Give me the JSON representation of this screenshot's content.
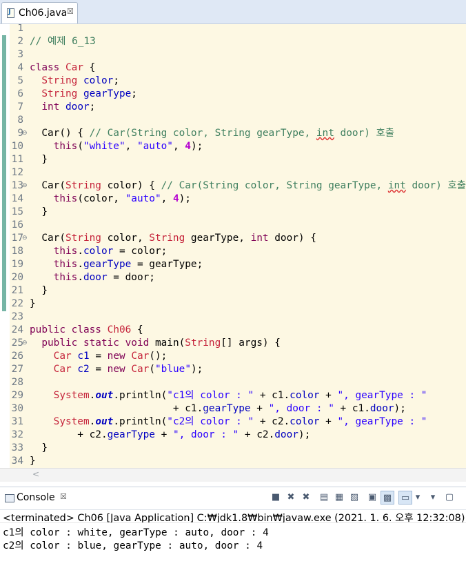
{
  "editor_tab": {
    "title": "Ch06.java",
    "close": "☒"
  },
  "code_lines": [
    {
      "n": "1",
      "fold": "",
      "segs": []
    },
    {
      "n": "2",
      "fold": "",
      "segs": [
        {
          "c": "cm",
          "t": "// 예제 6_13"
        }
      ]
    },
    {
      "n": "3",
      "fold": "",
      "segs": []
    },
    {
      "n": "4",
      "fold": "",
      "segs": [
        {
          "c": "kw",
          "t": "class"
        },
        {
          "c": "",
          "t": " "
        },
        {
          "c": "ty",
          "t": "Car"
        },
        {
          "c": "",
          "t": " {"
        }
      ]
    },
    {
      "n": "5",
      "fold": "",
      "segs": [
        {
          "c": "",
          "t": "  "
        },
        {
          "c": "ty",
          "t": "String"
        },
        {
          "c": "",
          "t": " "
        },
        {
          "c": "fd",
          "t": "color"
        },
        {
          "c": "",
          "t": ";"
        }
      ]
    },
    {
      "n": "6",
      "fold": "",
      "segs": [
        {
          "c": "",
          "t": "  "
        },
        {
          "c": "ty",
          "t": "String"
        },
        {
          "c": "",
          "t": " "
        },
        {
          "c": "fd",
          "t": "gearType"
        },
        {
          "c": "",
          "t": ";"
        }
      ]
    },
    {
      "n": "7",
      "fold": "",
      "segs": [
        {
          "c": "",
          "t": "  "
        },
        {
          "c": "kw",
          "t": "int"
        },
        {
          "c": "",
          "t": " "
        },
        {
          "c": "fd",
          "t": "door"
        },
        {
          "c": "",
          "t": ";"
        }
      ]
    },
    {
      "n": "8",
      "fold": "",
      "segs": []
    },
    {
      "n": "9",
      "fold": "⊖",
      "segs": [
        {
          "c": "",
          "t": "  Car() { "
        },
        {
          "c": "cm",
          "t": "// Car(String color, String gearType, "
        },
        {
          "c": "cm sq",
          "t": "int"
        },
        {
          "c": "cm",
          "t": " door) 호출"
        }
      ]
    },
    {
      "n": "10",
      "fold": "",
      "segs": [
        {
          "c": "",
          "t": "    "
        },
        {
          "c": "kw",
          "t": "this"
        },
        {
          "c": "",
          "t": "("
        },
        {
          "c": "st",
          "t": "\"white\""
        },
        {
          "c": "",
          "t": ", "
        },
        {
          "c": "st",
          "t": "\"auto\""
        },
        {
          "c": "",
          "t": ", "
        },
        {
          "c": "nm",
          "t": "4"
        },
        {
          "c": "",
          "t": ");"
        }
      ]
    },
    {
      "n": "11",
      "fold": "",
      "segs": [
        {
          "c": "",
          "t": "  }"
        }
      ]
    },
    {
      "n": "12",
      "fold": "",
      "segs": []
    },
    {
      "n": "13",
      "fold": "⊖",
      "segs": [
        {
          "c": "",
          "t": "  Car("
        },
        {
          "c": "ty",
          "t": "String"
        },
        {
          "c": "",
          "t": " color) { "
        },
        {
          "c": "cm",
          "t": "// Car(String color, String gearType, "
        },
        {
          "c": "cm sq",
          "t": "int"
        },
        {
          "c": "cm",
          "t": " door) 호출"
        }
      ]
    },
    {
      "n": "14",
      "fold": "",
      "segs": [
        {
          "c": "",
          "t": "    "
        },
        {
          "c": "kw",
          "t": "this"
        },
        {
          "c": "",
          "t": "(color, "
        },
        {
          "c": "st",
          "t": "\"auto\""
        },
        {
          "c": "",
          "t": ", "
        },
        {
          "c": "nm",
          "t": "4"
        },
        {
          "c": "",
          "t": ");"
        }
      ]
    },
    {
      "n": "15",
      "fold": "",
      "segs": [
        {
          "c": "",
          "t": "  }"
        }
      ]
    },
    {
      "n": "16",
      "fold": "",
      "segs": []
    },
    {
      "n": "17",
      "fold": "⊖",
      "segs": [
        {
          "c": "",
          "t": "  Car("
        },
        {
          "c": "ty",
          "t": "String"
        },
        {
          "c": "",
          "t": " color, "
        },
        {
          "c": "ty",
          "t": "String"
        },
        {
          "c": "",
          "t": " gearType, "
        },
        {
          "c": "kw",
          "t": "int"
        },
        {
          "c": "",
          "t": " door) {"
        }
      ]
    },
    {
      "n": "18",
      "fold": "",
      "segs": [
        {
          "c": "",
          "t": "    "
        },
        {
          "c": "kw",
          "t": "this"
        },
        {
          "c": "",
          "t": "."
        },
        {
          "c": "fd",
          "t": "color"
        },
        {
          "c": "",
          "t": " = color;"
        }
      ]
    },
    {
      "n": "19",
      "fold": "",
      "segs": [
        {
          "c": "",
          "t": "    "
        },
        {
          "c": "kw",
          "t": "this"
        },
        {
          "c": "",
          "t": "."
        },
        {
          "c": "fd",
          "t": "gearType"
        },
        {
          "c": "",
          "t": " = gearType;"
        }
      ]
    },
    {
      "n": "20",
      "fold": "",
      "segs": [
        {
          "c": "",
          "t": "    "
        },
        {
          "c": "kw",
          "t": "this"
        },
        {
          "c": "",
          "t": "."
        },
        {
          "c": "fd",
          "t": "door"
        },
        {
          "c": "",
          "t": " = door;"
        }
      ]
    },
    {
      "n": "21",
      "fold": "",
      "segs": [
        {
          "c": "",
          "t": "  }"
        }
      ]
    },
    {
      "n": "22",
      "fold": "",
      "segs": [
        {
          "c": "",
          "t": "}"
        }
      ]
    },
    {
      "n": "23",
      "fold": "",
      "segs": []
    },
    {
      "n": "24",
      "fold": "",
      "segs": [
        {
          "c": "kw",
          "t": "public"
        },
        {
          "c": "",
          "t": " "
        },
        {
          "c": "kw",
          "t": "class"
        },
        {
          "c": "",
          "t": " "
        },
        {
          "c": "ty",
          "t": "Ch06"
        },
        {
          "c": "",
          "t": " {"
        }
      ]
    },
    {
      "n": "25",
      "fold": "⊖",
      "segs": [
        {
          "c": "",
          "t": "  "
        },
        {
          "c": "kw",
          "t": "public"
        },
        {
          "c": "",
          "t": " "
        },
        {
          "c": "kw",
          "t": "static"
        },
        {
          "c": "",
          "t": " "
        },
        {
          "c": "kw",
          "t": "void"
        },
        {
          "c": "",
          "t": " main("
        },
        {
          "c": "ty",
          "t": "String"
        },
        {
          "c": "",
          "t": "[] args) {"
        }
      ]
    },
    {
      "n": "26",
      "fold": "",
      "segs": [
        {
          "c": "",
          "t": "    "
        },
        {
          "c": "ty",
          "t": "Car"
        },
        {
          "c": "",
          "t": " "
        },
        {
          "c": "cl",
          "t": "c1"
        },
        {
          "c": "",
          "t": " = "
        },
        {
          "c": "kw",
          "t": "new"
        },
        {
          "c": "",
          "t": " "
        },
        {
          "c": "ty",
          "t": "Car"
        },
        {
          "c": "",
          "t": "();"
        }
      ]
    },
    {
      "n": "27",
      "fold": "",
      "segs": [
        {
          "c": "",
          "t": "    "
        },
        {
          "c": "ty",
          "t": "Car"
        },
        {
          "c": "",
          "t": " "
        },
        {
          "c": "cl",
          "t": "c2"
        },
        {
          "c": "",
          "t": " = "
        },
        {
          "c": "kw",
          "t": "new"
        },
        {
          "c": "",
          "t": " "
        },
        {
          "c": "ty",
          "t": "Car"
        },
        {
          "c": "",
          "t": "("
        },
        {
          "c": "st",
          "t": "\"blue\""
        },
        {
          "c": "",
          "t": ");"
        }
      ]
    },
    {
      "n": "28",
      "fold": "",
      "segs": []
    },
    {
      "n": "29",
      "fold": "",
      "segs": [
        {
          "c": "",
          "t": "    "
        },
        {
          "c": "ty",
          "t": "System"
        },
        {
          "c": "",
          "t": "."
        },
        {
          "c": "sf",
          "t": "out"
        },
        {
          "c": "",
          "t": ".println("
        },
        {
          "c": "st",
          "t": "\"c1의 color : \""
        },
        {
          "c": "",
          "t": " + c1."
        },
        {
          "c": "fd",
          "t": "color"
        },
        {
          "c": "",
          "t": " + "
        },
        {
          "c": "st",
          "t": "\", gearType : \""
        }
      ]
    },
    {
      "n": "30",
      "fold": "",
      "segs": [
        {
          "c": "",
          "t": "                        + c1."
        },
        {
          "c": "fd",
          "t": "gearType"
        },
        {
          "c": "",
          "t": " + "
        },
        {
          "c": "st",
          "t": "\", door : \""
        },
        {
          "c": "",
          "t": " + c1."
        },
        {
          "c": "fd",
          "t": "door"
        },
        {
          "c": "",
          "t": ");"
        }
      ]
    },
    {
      "n": "31",
      "fold": "",
      "segs": [
        {
          "c": "",
          "t": "    "
        },
        {
          "c": "ty",
          "t": "System"
        },
        {
          "c": "",
          "t": "."
        },
        {
          "c": "sf",
          "t": "out"
        },
        {
          "c": "",
          "t": ".println("
        },
        {
          "c": "st",
          "t": "\"c2의 color : \""
        },
        {
          "c": "",
          "t": " + c2."
        },
        {
          "c": "fd",
          "t": "color"
        },
        {
          "c": "",
          "t": " + "
        },
        {
          "c": "st",
          "t": "\", gearType : \""
        }
      ]
    },
    {
      "n": "32",
      "fold": "",
      "segs": [
        {
          "c": "",
          "t": "        + c2."
        },
        {
          "c": "fd",
          "t": "gearType"
        },
        {
          "c": "",
          "t": " + "
        },
        {
          "c": "st",
          "t": "\", door : \""
        },
        {
          "c": "",
          "t": " + c2."
        },
        {
          "c": "fd",
          "t": "door"
        },
        {
          "c": "",
          "t": ");"
        }
      ]
    },
    {
      "n": "33",
      "fold": "",
      "segs": [
        {
          "c": "",
          "t": "  }"
        }
      ]
    },
    {
      "n": "34",
      "fold": "",
      "segs": [
        {
          "c": "",
          "t": "}"
        }
      ]
    }
  ],
  "scroll_arrow": "<",
  "console": {
    "title": "Console",
    "close": "☒",
    "toolbar": [
      "■",
      "✖",
      "✖",
      "▤",
      "▦",
      "▧",
      "▣",
      "▩",
      "▭",
      "▾",
      "▾",
      "▢"
    ],
    "status": "<terminated> Ch06 [Java Application] C:₩jdk1.8₩bin₩javaw.exe (2021. 1. 6. 오후 12:32:08)",
    "output": [
      "c1의 color : white, gearType : auto, door : 4",
      "c2의 color : blue, gearType : auto, door : 4"
    ]
  },
  "colors": {
    "editor_bg": "#fdf8e3",
    "keyword": "#7f0055",
    "type": "#c5233a",
    "field": "#0000c0",
    "string": "#2a00ff",
    "number": "#b400d0",
    "comment": "#3f7f5f",
    "quickdiff": "#76b5a6"
  }
}
